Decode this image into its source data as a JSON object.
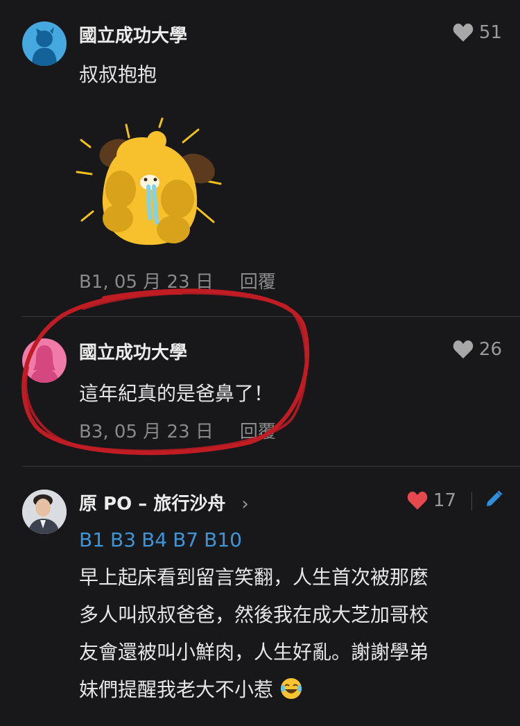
{
  "comments": [
    {
      "author": "國立成功大學",
      "likes": "51",
      "text": "叔叔抱抱",
      "floor": "B1, 05 月 23 日",
      "reply": "回覆",
      "avatar_color": "#45a9e0"
    },
    {
      "author": "國立成功大學",
      "likes": "26",
      "text": "這年紀真的是爸鼻了！",
      "floor": "B3, 05 月 23 日",
      "reply": "回覆",
      "avatar_color": "#f07aa8"
    },
    {
      "author": "原 PO – 旅行沙舟",
      "likes": "17",
      "tags": [
        "B1",
        "B3",
        "B4",
        "B7",
        "B10"
      ],
      "lines": [
        "早上起床看到留言笑翻，人生首次被那麼",
        "多人叫叔叔爸爸，然後我在成大芝加哥校",
        "友會還被叫小鮮肉，人生好亂。謝謝學弟",
        "妹們提醒我老大不小惹"
      ]
    }
  ],
  "colors": {
    "background": "#18181a",
    "highlight_circle": "#c01c24",
    "liked_heart": "#e5484d",
    "tag_blue": "#3f95d6",
    "edit_icon": "#2f8fdc"
  }
}
